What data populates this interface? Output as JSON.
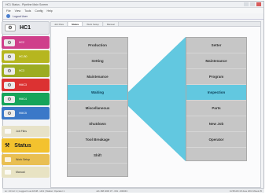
{
  "window": {
    "title": "HC1 Status - Pipeline Main Screen"
  },
  "menu": [
    "File",
    "View",
    "Tools",
    "Config",
    "Help"
  ],
  "user": {
    "label": "Logout User"
  },
  "machines": [
    {
      "label": "HC1",
      "color": "#e6e8ec"
    },
    {
      "label": "HC2",
      "color": "#cf3f8b"
    },
    {
      "label": "HC-B0",
      "color": "#b6b61f"
    },
    {
      "label": "HC3",
      "color": "#9cac22"
    },
    {
      "label": "HMC3",
      "color": "#dc3232"
    },
    {
      "label": "HMC4",
      "color": "#16a45a"
    },
    {
      "label": "HMC5",
      "color": "#3b78c8"
    }
  ],
  "nav": {
    "jobs": "Job Files",
    "status": "Status",
    "work": "Work Setup",
    "manual": "Manual"
  },
  "tabs": [
    "Job Files",
    "Status",
    "Work Setup",
    "Manual"
  ],
  "active_tab": "Status",
  "status_left": [
    "Production",
    "Setting",
    "Maintenance",
    "Waiting",
    "Miscellaneous",
    "Shutdown",
    "Tool Breakage",
    "Shift"
  ],
  "status_right": [
    "Setter",
    "Maintenance",
    "Program",
    "Inspection",
    "Parts",
    "New Job",
    "Operator"
  ],
  "selected": {
    "left": "Waiting",
    "right": "Inspection"
  },
  "statusbar": {
    "left": "Ln: 13 Col: 1 | Logged in as 18-08 - HC1 | Station: Operator 1",
    "middle": "Job 188 4000 37 - 001 - 000043",
    "right": "11:58 AM  18 June 2013 Week 25"
  }
}
